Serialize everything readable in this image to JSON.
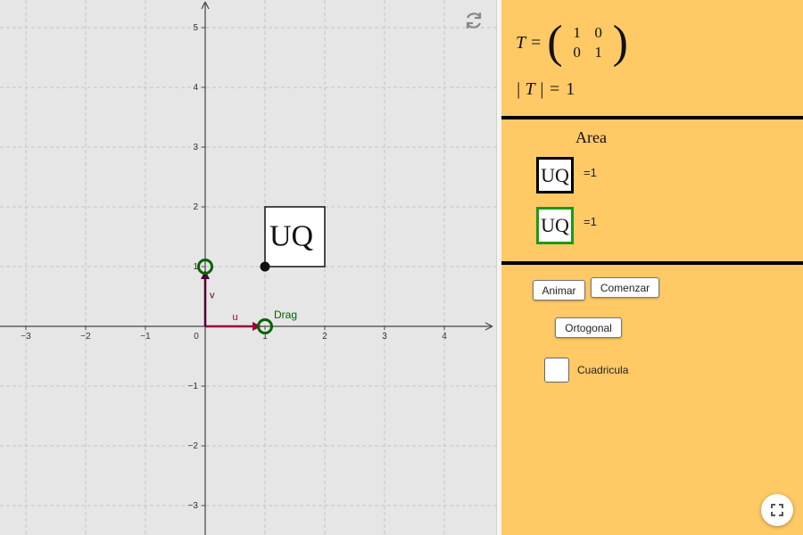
{
  "graph": {
    "x_ticks": [
      "−3",
      "−2",
      "−1",
      "1",
      "2",
      "3",
      "4"
    ],
    "origin_label": "0",
    "y_ticks_pos": [
      "1",
      "2",
      "3",
      "4",
      "5"
    ],
    "y_ticks_neg": [
      "−1",
      "−2",
      "−3"
    ],
    "vector_u_label": "u",
    "vector_v_label": "v",
    "drag_label": "Drag",
    "uq_label": "UQ",
    "colors": {
      "u": "#99003d",
      "v": "#4d0033",
      "handle": "#006400",
      "drag_text": "#006400"
    }
  },
  "matrix": {
    "lhs": "T =",
    "row1": [
      "1",
      "0"
    ],
    "row2": [
      "0",
      "1"
    ],
    "det_lhs": "| T | =",
    "det_value": "1"
  },
  "area": {
    "title": "Area",
    "original": {
      "label": "UQ",
      "value": "=1",
      "color": "#000000"
    },
    "transformed": {
      "label": "UQ",
      "value": "=1",
      "color": "#1a9a1a"
    }
  },
  "controls": {
    "animate_label": "Animar",
    "start_label": "Comenzar",
    "orthogonal_label": "Ortogonal",
    "grid_label": "Cuadricula",
    "grid_checked": false
  },
  "panel_color": "#ffc966"
}
